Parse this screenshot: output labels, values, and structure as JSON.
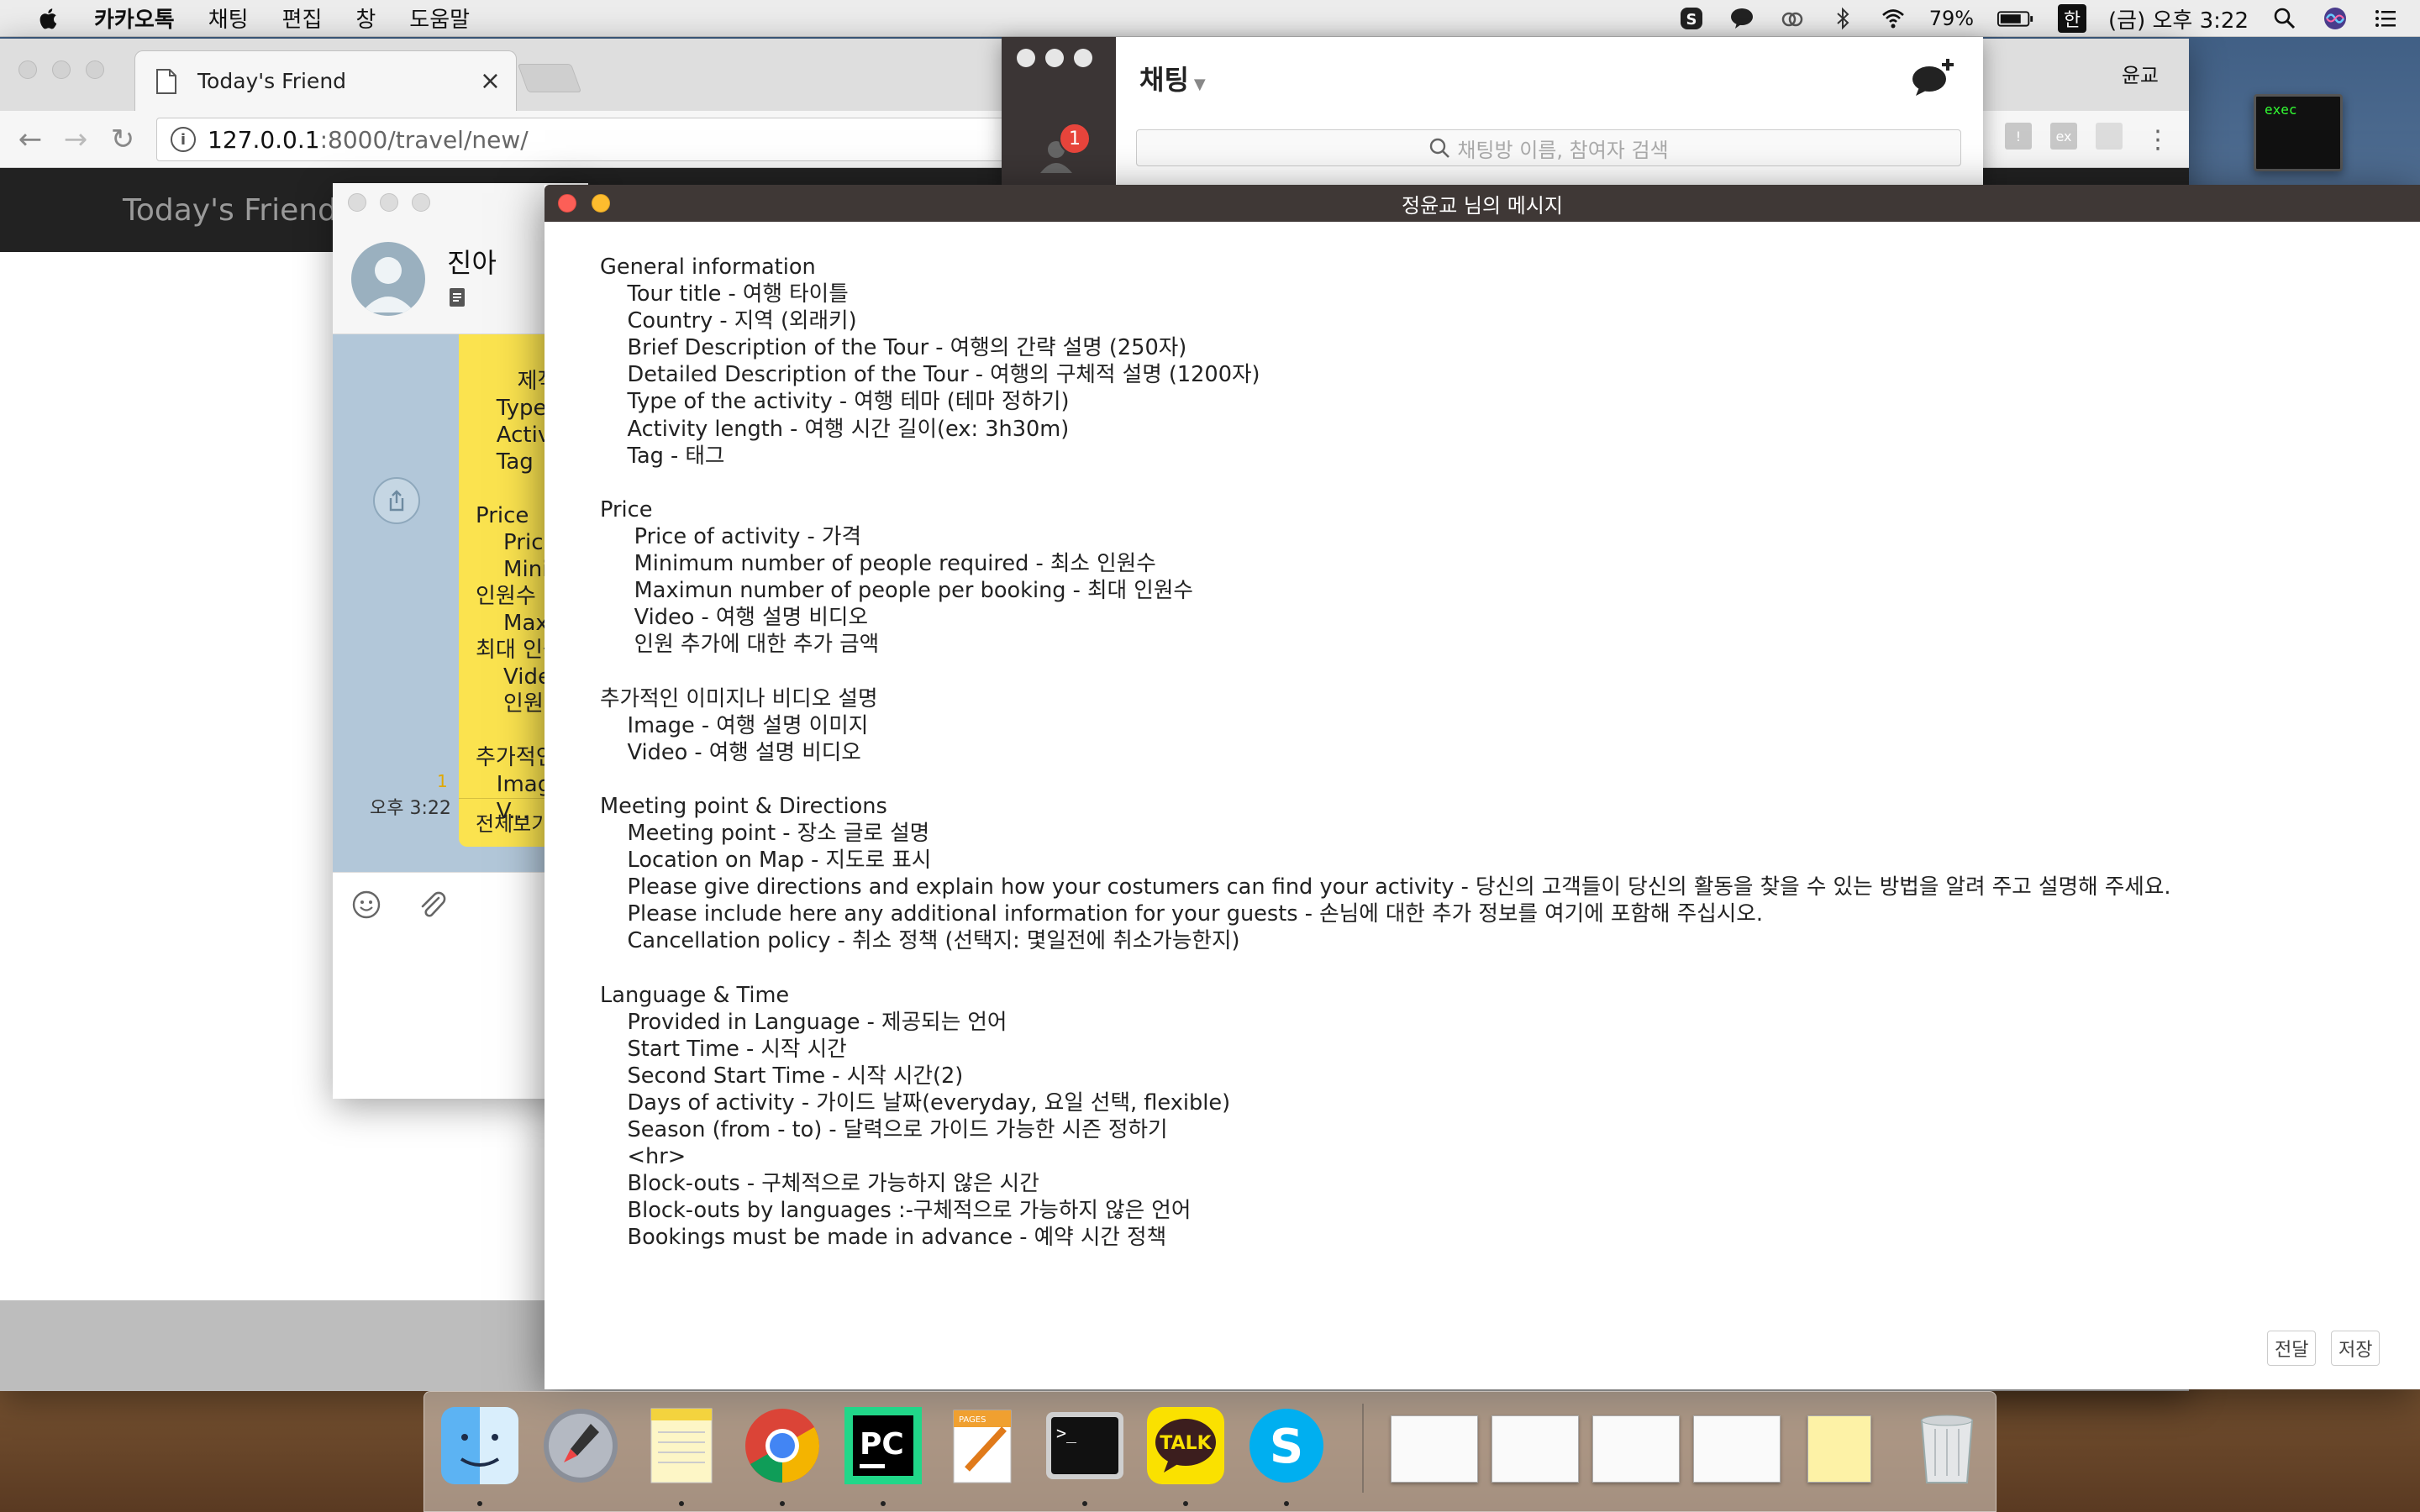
{
  "menubar": {
    "app_name": "카카오톡",
    "menus": [
      "채팅",
      "편집",
      "창",
      "도움말"
    ],
    "battery": "79%",
    "input_source": "한",
    "datetime": "(금) 오후 3:22"
  },
  "browser": {
    "tab_title": "Today's Friend",
    "url_host": "127.0.0.1",
    "url_rest": ":8000/travel/new/",
    "profile_name": "윤교",
    "site_brand": "Today's Friend"
  },
  "terminal_thumb": {
    "label": "exec"
  },
  "chat_list": {
    "title": "채팅",
    "unread_badge": "1",
    "search_placeholder": "채팅방 이름, 참여자 검색"
  },
  "chat": {
    "contact_name": "진아",
    "bubble_preview": "제작 설명\n   Type\n   Activ\n   Tag\n\nPrice\n    Pric\n    Mini\n인원수\n    Max\n최대 인원\n    Vide\n    인원\n\n추가적인\n   Imag\n   V...",
    "see_all": "전체보기",
    "unread_count": "1",
    "time": "오후 3:22"
  },
  "message_window": {
    "title": "정윤교 님의 메시지",
    "body": "General information\n    Tour title - 여행 타이틀\n    Country - 지역 (외래키)\n    Brief Description of the Tour - 여행의 간략 설명 (250자)\n    Detailed Description of the Tour - 여행의 구체적 설명 (1200자)\n    Type of the activity - 여행 테마 (테마 정하기)\n    Activity length - 여행 시간 길이(ex: 3h30m)\n    Tag - 태그\n\nPrice\n     Price of activity - 가격\n     Minimum number of people required - 최소 인원수\n     Maximun number of people per booking - 최대 인원수\n     Video - 여행 설명 비디오\n     인원 추가에 대한 추가 금액\n\n추가적인 이미지나 비디오 설명\n    Image - 여행 설명 이미지\n    Video - 여행 설명 비디오\n\nMeeting point & Directions\n    Meeting point - 장소 글로 설명\n    Location on Map - 지도로 표시\n    Please give directions and explain how your costumers can find your activity - 당신의 고객들이 당신의 활동을 찾을 수 있는 방법을 알려 주고 설명해 주세요.\n    Please include here any additional information for your guests - 손님에 대한 추가 정보를 여기에 포함해 주십시오.\n    Cancellation policy - 취소 정책 (선택지: 몇일전에 취소가능한지)\n\nLanguage & Time\n    Provided in Language - 제공되는 언어\n    Start Time - 시작 시간\n    Second Start Time - 시작 시간(2)\n    Days of activity - 가이드 날짜(everyday, 요일 선택, flexible)\n    Season (from - to) - 달력으로 가이드 가능한 시즌 정하기\n    <hr>\n    Block-outs - 구체적으로 가능하지 않은 시간\n    Block-outs by languages :-구체적으로 가능하지 않은 언어\n    Bookings must be made in advance - 예약 시간 정책",
    "forward_button": "전달",
    "save_button": "저장"
  },
  "dock": {
    "apps": [
      "finder-icon",
      "launchpad-icon",
      "notes-icon",
      "chrome-icon",
      "pycharm-icon",
      "pages-icon",
      "terminal-icon",
      "kakaotalk-icon",
      "skype-icon"
    ],
    "pycharm_label": "PC",
    "kakaotalk_label": "TALK",
    "terminal_label": ">_",
    "pages_label": "PAGES"
  }
}
